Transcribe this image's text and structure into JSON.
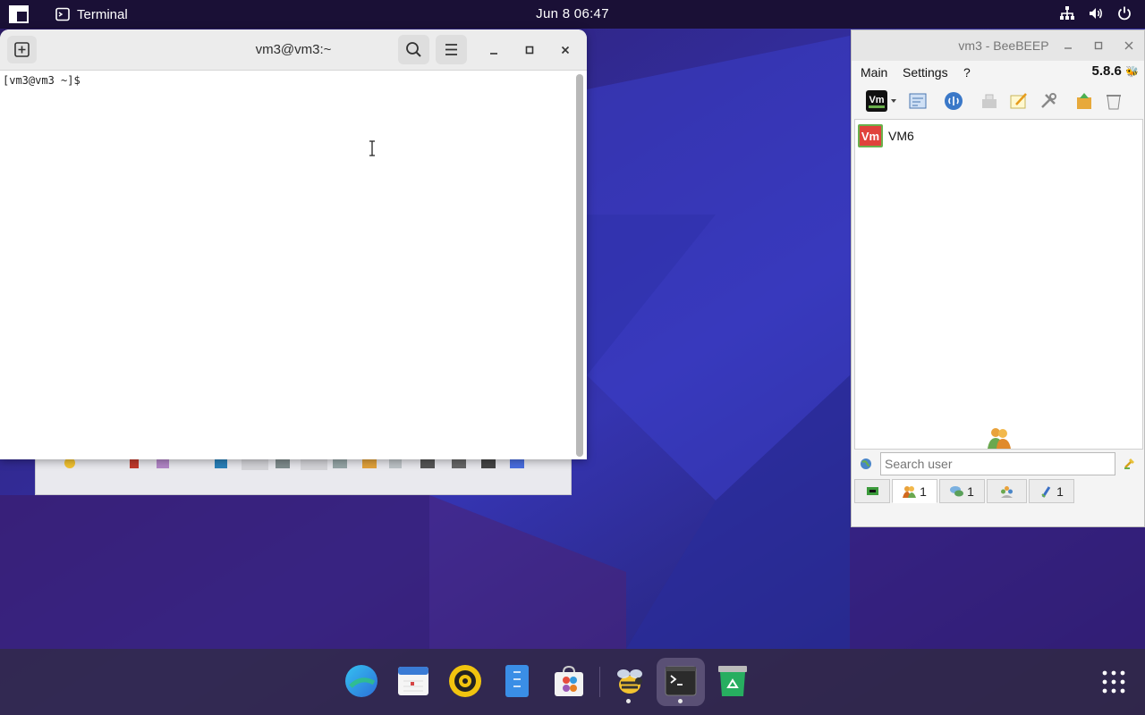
{
  "topbar": {
    "active_app": "Terminal",
    "clock": "Jun 8  06:47",
    "tray_icons": [
      "network-icon",
      "volume-icon",
      "power-icon"
    ]
  },
  "terminal": {
    "title": "vm3@vm3:~",
    "prompt": "[vm3@vm3 ~]$"
  },
  "beebeep": {
    "window_title": "vm3 - BeeBEEP",
    "menu": [
      "Main",
      "Settings",
      "?"
    ],
    "version": "5.8.6",
    "users": [
      {
        "avatar_text": "Vm",
        "name": "VM6"
      }
    ],
    "search": {
      "placeholder": "Search user",
      "value": ""
    },
    "tabs": [
      {
        "icon": "status-icon",
        "count": ""
      },
      {
        "icon": "users-icon",
        "count": "1"
      },
      {
        "icon": "chats-icon",
        "count": "1"
      },
      {
        "icon": "groups-icon",
        "count": ""
      },
      {
        "icon": "files-icon",
        "count": "1"
      }
    ]
  },
  "dock": {
    "apps": [
      "browser-icon",
      "calendar-icon",
      "music-icon",
      "files-icon",
      "software-store-icon",
      "beebeep-icon",
      "terminal-icon",
      "recycle-icon"
    ],
    "running": [
      "beebeep-icon",
      "terminal-icon"
    ]
  },
  "colors": {
    "topbar": "#1a1036",
    "wallpaper_dark": "#2a1a5e",
    "wallpaper_blue": "#3a3cc4",
    "accent_red": "#e0433c"
  }
}
